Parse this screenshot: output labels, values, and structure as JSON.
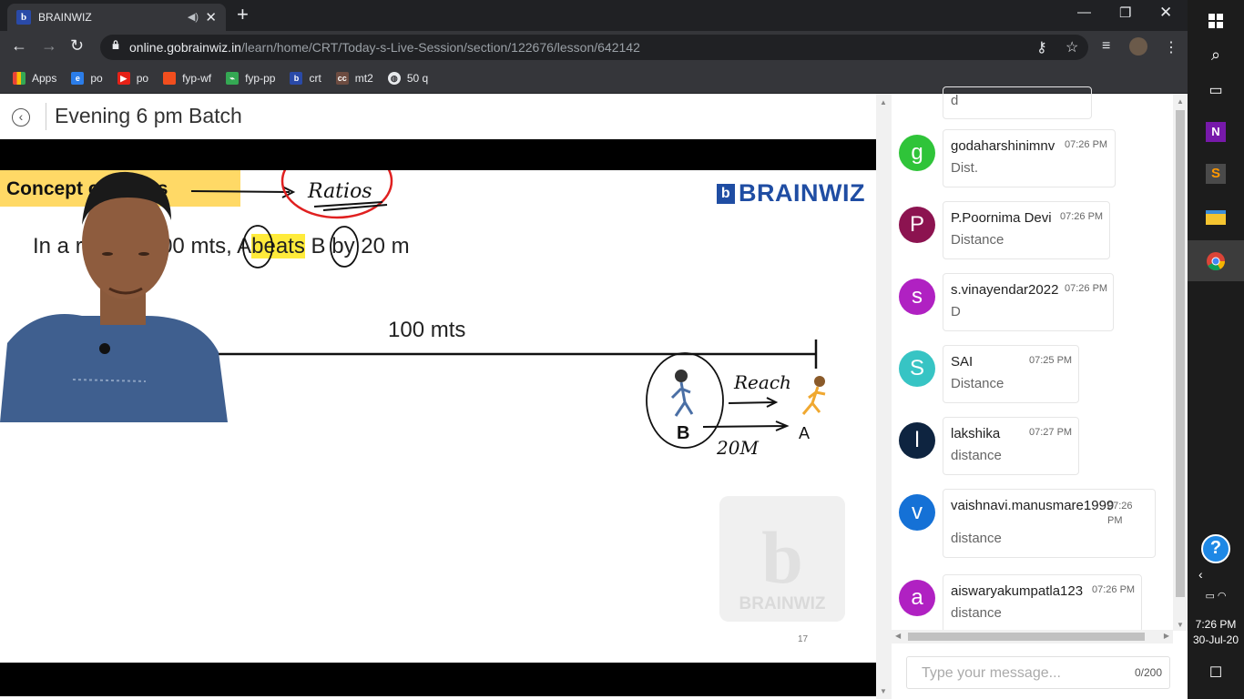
{
  "browser": {
    "tab_title": "BRAINWIZ",
    "tab_favicon": "b",
    "url_host": "online.gobrainwiz.in",
    "url_path": "/learn/home/CRT/Today-s-Live-Session/section/122676/lesson/642142",
    "bookmarks": [
      {
        "label": "Apps",
        "icon": "apps-grid-icon",
        "color": "#e8eaed"
      },
      {
        "label": "po",
        "icon": "edge-icon",
        "color": "#2b7de9"
      },
      {
        "label": "po",
        "icon": "youtube-icon",
        "color": "#e62117"
      },
      {
        "label": "fyp-wf",
        "icon": "figma-icon",
        "color": "#f24e1e"
      },
      {
        "label": "fyp-pp",
        "icon": "chart-icon",
        "color": "#34a853"
      },
      {
        "label": "crt",
        "icon": "brainwiz-icon",
        "color": "#2a4aa8"
      },
      {
        "label": "mt2",
        "icon": "cc-icon",
        "color": "#6d4c41"
      },
      {
        "label": "50 q",
        "icon": "globe-icon",
        "color": "#e8eaed"
      }
    ]
  },
  "page": {
    "title": "Evening 6 pm Batch"
  },
  "slide": {
    "heading": "Concept of Races",
    "logo_text": "BRAINWIZ",
    "problem_prefix": "In a race of 100 mts,",
    "problem_a": "A",
    "problem_beats": "beats",
    "problem_b": "B",
    "problem_suffix": "by 20 m",
    "track_label": "100 mts",
    "annotation_ratios": "Ratios",
    "annotation_reach": "Reach",
    "annotation_distance": "20M",
    "runner_b": "B",
    "runner_a": "A",
    "watermark_text": "BRAINWIZ",
    "slide_number": "17"
  },
  "chat": {
    "partial_text": "d",
    "messages": [
      {
        "initial": "g",
        "color": "#2fc439",
        "name": "godaharshinimnv",
        "time": "07:26 PM",
        "text": "Dist."
      },
      {
        "initial": "P",
        "color": "#8c1350",
        "name": "P.Poornima Devi",
        "time": "07:26 PM",
        "text": "Distance"
      },
      {
        "initial": "s",
        "color": "#b021c2",
        "name": "s.vinayendar2022",
        "time": "07:26 PM",
        "text": "D"
      },
      {
        "initial": "S",
        "color": "#37c4c4",
        "name": "SAI",
        "time": "07:25 PM",
        "text": "Distance"
      },
      {
        "initial": "l",
        "color": "#0e2440",
        "name": "lakshika",
        "time": "07:27 PM",
        "text": "distance"
      },
      {
        "initial": "v",
        "color": "#1571d6",
        "name": "vaishnavi.manusmare1999",
        "time": "07:26 PM",
        "text": "distance"
      },
      {
        "initial": "a",
        "color": "#b021c2",
        "name": "aiswaryakumpatla123",
        "time": "07:26 PM",
        "text": "distance"
      }
    ],
    "input_placeholder": "Type your message...",
    "char_count": "0/200"
  },
  "taskbar": {
    "time": "7:26 PM",
    "date": "30-Jul-20"
  }
}
